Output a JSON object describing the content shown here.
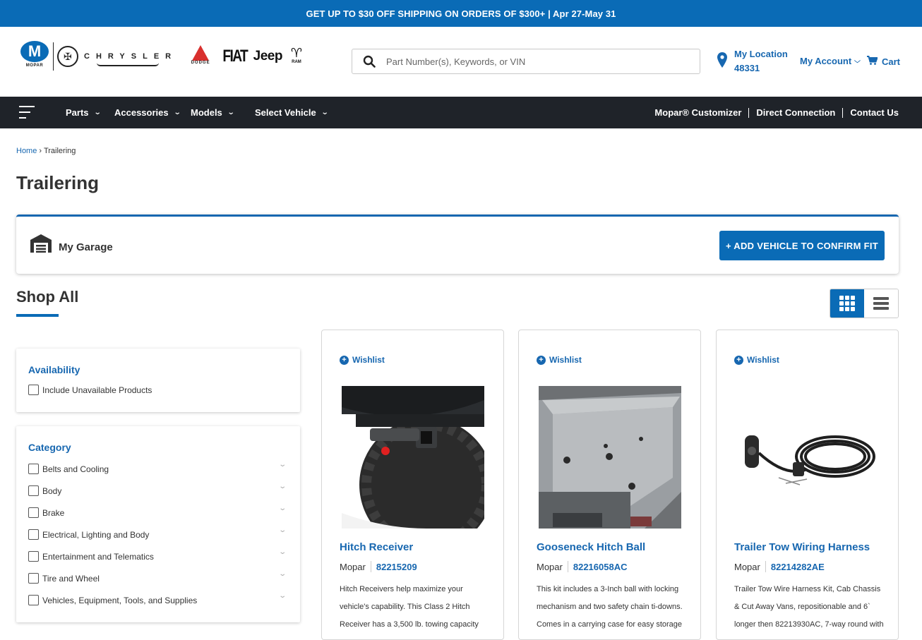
{
  "promo": {
    "text": "GET UP TO $30 OFF SHIPPING ON ORDERS OF $300+ | Apr 27-May 31"
  },
  "brands": {
    "mopar": "MOPAR",
    "chrysler": "CHRYSLER",
    "dodge": "DODGE",
    "fiat": "FIAT",
    "jeep": "Jeep",
    "ram": "RAM"
  },
  "search": {
    "placeholder": "Part Number(s), Keywords, or VIN"
  },
  "location": {
    "label": "My Location",
    "zip": "48331"
  },
  "account": {
    "label": "My Account"
  },
  "cart": {
    "label": "Cart"
  },
  "nav": {
    "items": [
      "Parts",
      "Accessories",
      "Models",
      "Select Vehicle"
    ],
    "right": [
      "Mopar® Customizer",
      "Direct Connection",
      "Contact Us"
    ]
  },
  "breadcrumb": {
    "home": "Home",
    "current": "Trailering"
  },
  "page": {
    "title": "Trailering"
  },
  "garage": {
    "label": "My Garage",
    "button": "+ ADD VEHICLE TO CONFIRM FIT"
  },
  "shop_all": {
    "title": "Shop All"
  },
  "facets": {
    "availability": {
      "title": "Availability",
      "option": "Include Unavailable Products"
    },
    "category": {
      "title": "Category",
      "options": [
        "Belts and Cooling",
        "Body",
        "Brake",
        "Electrical, Lighting and Body",
        "Entertainment and Telematics",
        "Tire and Wheel",
        "Vehicles, Equipment, Tools, and Supplies"
      ]
    }
  },
  "products": [
    {
      "wishlist": "Wishlist",
      "name": "Hitch Receiver",
      "brand": "Mopar",
      "part_number": "82215209",
      "description": "Hitch Receivers help maximize your vehicle's capability. This Class 2 Hitch Receiver has a 3,500 lb. towing capacity"
    },
    {
      "wishlist": "Wishlist",
      "name": "Gooseneck Hitch Ball",
      "brand": "Mopar",
      "part_number": "82216058AC",
      "description": "This kit includes a 3-Inch ball with locking mechanism and two safety chain ti-downs. Comes in a carrying case for easy storage"
    },
    {
      "wishlist": "Wishlist",
      "name": "Trailer Tow Wiring Harness",
      "brand": "Mopar",
      "part_number": "82214282AE",
      "description": "Trailer Tow Wire Harness Kit, Cab Chassis & Cut Away Vans, repositionable and 6` longer then 82213930AC, 7-way round with"
    }
  ],
  "colors": {
    "brand_blue": "#0a6bb6",
    "link_blue": "#1767b0",
    "nav_bg": "#1f2329"
  }
}
